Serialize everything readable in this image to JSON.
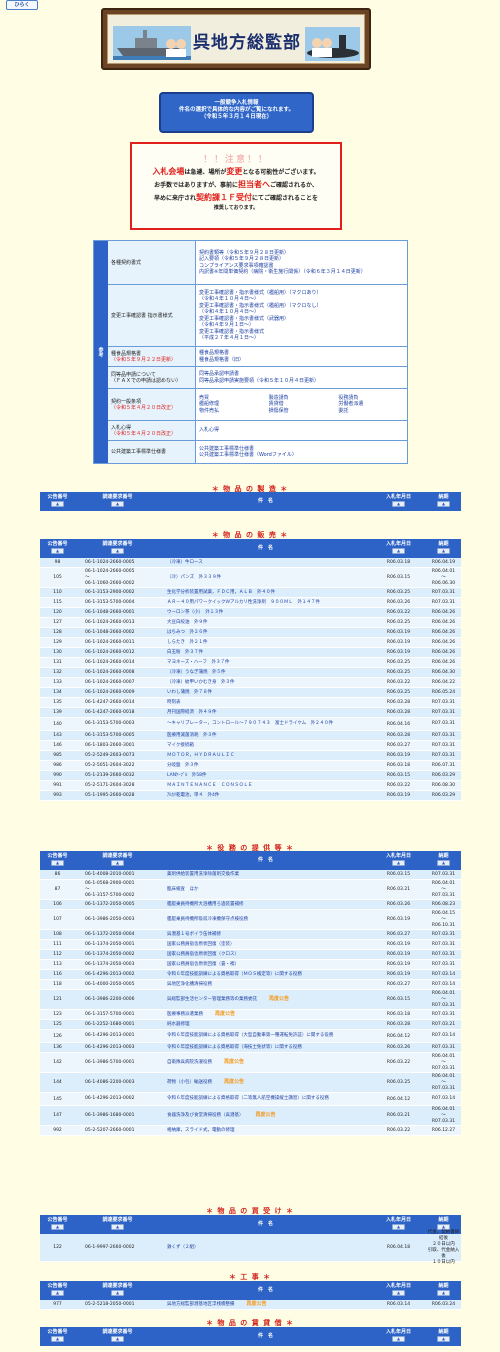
{
  "top": {
    "open_label": "ひらく"
  },
  "banner": {
    "title": "呉地方総監部"
  },
  "info": {
    "line1": "一般競争入札情報",
    "line2": "件名の選択で具体的な内容がご覧になれます。",
    "line3": "（令和５年３月１４日現在）"
  },
  "alert": {
    "title": "！！注意！！",
    "l1a": "入札会場",
    "l1b": "は急遽、場所が",
    "l1c": "変更",
    "l1d": "となる可能性がございます。",
    "l2a": "お手数ではありますが、事前に",
    "l2b": "担当者へ",
    "l2c": "ご確認されるか、",
    "l3a": "早めに来庁され",
    "l3b": "契約課１Ｆ受付",
    "l3c": "にてご確認されることを",
    "l4": "推奨しております。"
  },
  "links": {
    "side": "参考",
    "rows": [
      {
        "label": "各種契約書式",
        "values": [
          "契約書類等（令和５年９月２８日更新）",
          "記入要領（令和５年９月２８日更新）",
          "コンプライアンス要求事項確認書",
          "内訳書※年間単価契約（病院・衛生施行関係）（令和６年３月１４日更新）"
        ]
      },
      {
        "label": "変更工事確認書\n指示書様式",
        "values": [
          "変更工事確認書・指示書様式（艦船用）（マクロあり）",
          "（令和４年１０月４日～）",
          "変更工事確認書・指示書様式（艦船用）（マクロなし）",
          "（令和４年１０月４日～）",
          "変更工事確認書・指示書様式（武器用）",
          "（令和４年９月１日～）",
          "変更工事確認書・指示書様式",
          "（平成２７年４月１日～）"
        ]
      },
      {
        "label": "種食品規格書",
        "note": "（令和５年９月２２日更新）",
        "values": [
          "種食品規格書",
          "種食品規格書（旧）"
        ]
      },
      {
        "label": "同等品申請について",
        "note2": "（ＦＡＸでの申請は認めない）",
        "values": [
          "同等品承認申請書",
          "同等品承認申請実施要領（令和５年１０月４日更新）"
        ]
      },
      {
        "label": "契約一般条項",
        "note": "（令和５年４月２０日改正）",
        "grid": [
          "売買",
          "製造請負",
          "役務請負",
          "艦船修理",
          "賃貸借",
          "労働者派遣",
          "物件売払",
          "損傷保管",
          "委託"
        ]
      },
      {
        "label": "入札心得",
        "note": "（令和５年４月２０日改正）",
        "values": [
          "入札心得"
        ]
      },
      {
        "label": "公共建築工事標準仕様書",
        "values": [
          "公共建築工事標準仕様書",
          "公共建築工事標準仕様書（Wordファイル）"
        ]
      }
    ]
  },
  "headers": {
    "no": "公告番号",
    "code": "調達要求番号",
    "name": "件　名",
    "date": "入札年月日",
    "due": "納期",
    "sort": "▲"
  },
  "sections": {
    "seizo": {
      "title": "＊ 物 品 の 製 造 ＊"
    },
    "hanbai": {
      "title": "＊ 物 品 の 販 売 ＊",
      "rows": [
        {
          "no": "98",
          "code": "06-1-1024-2660-0005",
          "name": "（冷凍）牛ロース",
          "date": "R06.03.18",
          "due": "R06.04.19"
        },
        {
          "no": "105",
          "code": "06-1-1024-2660-0005\n～\n06-1-1060-2660-0002",
          "name": "（冷）パンズ　外３３９件",
          "date": "R06.03.15",
          "due": "R06.04.01\n～\nR06.06.30"
        },
        {
          "no": "110",
          "code": "06-1-3153-2900-0002",
          "name": "生化学分析装置用試薬，ＦＤＣ用，ＡＬＢ　外４０件",
          "date": "R06.03.25",
          "due": "R07.03.31"
        },
        {
          "no": "115",
          "code": "06-1-3153-5700-0004",
          "name": "ＡＲ－４０用パワークイックＷアルカリ性洗浄剤　９００ＭＬ　外１４７件",
          "date": "R06.03.26",
          "due": "R07.03.31"
        },
        {
          "no": "120",
          "code": "06-1-1048-2660-0001",
          "name": "ウーロン茶（小）　外１３件",
          "date": "R06.03.22",
          "due": "R06.04.26"
        },
        {
          "no": "127",
          "code": "06-1-1024-2660-0013",
          "name": "大豆白絞油　外９件",
          "date": "R06.03.25",
          "due": "R06.04.26"
        },
        {
          "no": "128",
          "code": "06-1-1048-2660-0002",
          "name": "はちみつ　外２６件",
          "date": "R06.03.19",
          "due": "R06.04.26"
        },
        {
          "no": "129",
          "code": "06-1-1024-2660-0011",
          "name": "しらたき　外２１件",
          "date": "R06.03.19",
          "due": "R06.04.26"
        },
        {
          "no": "130",
          "code": "06-1-1024-2660-0012",
          "name": "白玉粉　外３７件",
          "date": "R06.03.19",
          "due": "R06.04.26"
        },
        {
          "no": "131",
          "code": "06-1-1024-2660-0014",
          "name": "マヨネーズ・ハーフ　外３７件",
          "date": "R06.03.25",
          "due": "R06.04.26"
        },
        {
          "no": "132",
          "code": "06-1-1024-2660-0008",
          "name": "（冷凍）うなぎ蒲焼　外５件",
          "date": "R06.03.25",
          "due": "R06.04.30"
        },
        {
          "no": "133",
          "code": "06-1-1024-2660-0007",
          "name": "（冷凍）紋甲いかむき身　外３件",
          "date": "R06.03.22",
          "due": "R06.04.22"
        },
        {
          "no": "134",
          "code": "06-1-1024-2660-0009",
          "name": "いわし蒲焼　外７８件",
          "date": "R06.03.25",
          "due": "R06.05.24"
        },
        {
          "no": "135",
          "code": "06-1-4247-2660-0014",
          "name": "時刻表",
          "date": "R06.03.28",
          "due": "R07.03.31"
        },
        {
          "no": "139",
          "code": "06-1-4247-2660-0018",
          "name": "月刊国際経済　外４９件",
          "date": "R06.03.28",
          "due": "R07.03.31"
        },
        {
          "no": "140",
          "code": "06-1-3153-5700-0003",
          "name": "～キャリブレーター，コントロール～７９０７４３　富士ドライケム　外２４０件",
          "date": "R06.04.16",
          "due": "R07.03.31"
        },
        {
          "no": "143",
          "code": "06-1-3153-5700-0005",
          "name": "医療用滅菌消耗　外３件",
          "date": "R06.03.28",
          "due": "R07.03.31"
        },
        {
          "no": "146",
          "code": "06-1-1803-2660-3001",
          "name": "マイク接続箱",
          "date": "R06.03.27",
          "due": "R07.03.31"
        },
        {
          "no": "985",
          "code": "05-2-5249-2603-0073",
          "name": "ＭＯＴＯＲ，ＨＹＤＲＡＵＬＩＣ",
          "date": "R06.03.19",
          "due": "R07.03.31"
        },
        {
          "no": "986",
          "code": "05-2-5051-2604-3022",
          "name": "分岐盤　外３件",
          "date": "R06.03.18",
          "due": "R06.07.31"
        },
        {
          "no": "990",
          "code": "05-1-2139-2660-0032",
          "name": "LANｹｰﾌﾞﾙ　外58件",
          "date": "R06.03.15",
          "due": "R06.03.29"
        },
        {
          "no": "991",
          "code": "05-2-5171-2604-3028",
          "name": "ＭＡＩＮＴＥＮＡＮＣＥ　ＣＯＮＳＯＬＥ",
          "date": "R06.03.22",
          "due": "R06.08.30"
        },
        {
          "no": "993",
          "code": "05-1-1995-2660-0028",
          "name": "ｱﾙｶﾘ乾電池，単４　外4件",
          "date": "R06.03.19",
          "due": "R06.03.29"
        }
      ]
    },
    "ekimu": {
      "title": "＊ 役 務 の 提 供 等 ＊",
      "rows": [
        {
          "no": "86",
          "code": "06-1-4008-2010-0001",
          "name": "薬剤供給装置用洗浄除菌剤交換作業",
          "date": "R06.03.15",
          "due": "R07.03.31"
        },
        {
          "no": "87",
          "code": "06-1-0568-2900-0001\n～\n06-1-3157-5700-0002",
          "name": "臨床検査　ほか",
          "date": "R06.03.21",
          "due": "R06.04.01\n～\nR07.03.31"
        },
        {
          "no": "106",
          "code": "06-1-1372-2050-0005",
          "name": "艦艇乗員待機所大浴槽用ろ過装置補修",
          "date": "R06.03.26",
          "due": "R06.08.23"
        },
        {
          "no": "107",
          "code": "06-1-3986-2050-0003",
          "name": "艦艇乗員待機所吸収冷凍機保守点検役務",
          "date": "R06.03.19",
          "due": "R06.04.15\n～\nR06.10.31"
        },
        {
          "no": "108",
          "code": "06-1-1372-2050-0004",
          "name": "呉潜基１号ボイラ缶体補修",
          "date": "R06.03.27",
          "due": "R07.03.31"
        },
        {
          "no": "111",
          "code": "06-1-1374-2050-0001",
          "name": "国家公務員宿舎原状回復（塗装）",
          "date": "R06.03.19",
          "due": "R07.03.31"
        },
        {
          "no": "112",
          "code": "06-1-1374-2050-0002",
          "name": "国家公務員宿舎原状回復（クロス）",
          "date": "R06.03.19",
          "due": "R07.03.31"
        },
        {
          "no": "113",
          "code": "06-1-1374-2050-0003",
          "name": "国家公務員宿舎原状回復（畳・襖）",
          "date": "R06.03.19",
          "due": "R07.03.31"
        },
        {
          "no": "116",
          "code": "06-1-4296-2013-0002",
          "name": "令和６年度技能訓練による資格取得（ＭＯＳ検定等）に関する役務",
          "date": "R06.03.19",
          "due": "R07.03.14"
        },
        {
          "no": "118",
          "code": "06-1-4000-2050-0005",
          "name": "呉地区浄化槽清掃役務",
          "date": "R06.03.27",
          "due": "R07.03.14"
        },
        {
          "no": "121",
          "code": "06-1-3986-2200-0006",
          "name": "呉総監部生活センター管理業務等の業務委託",
          "tag": "再度公告",
          "date": "R06.03.15",
          "due": "R06.04.01\n～\nR07.03.31"
        },
        {
          "no": "123",
          "code": "06-1-3157-5700-0001",
          "name": "医療事務派遣業務",
          "tag": "再度公告",
          "date": "R06.03.18",
          "due": "R07.03.31"
        },
        {
          "no": "125",
          "code": "06-1-2252-1680-0001",
          "name": "純水器修理",
          "date": "R06.03.28",
          "due": "R07.03.21"
        },
        {
          "no": "126",
          "code": "06-1-4296-2013-0001",
          "name": "令和６年度技能訓練による資格取得（大型自動車第一種運転免許証）に関する役務",
          "date": "R06.04.12",
          "due": "R07.03.14"
        },
        {
          "no": "136",
          "code": "06-1-4296-2013-0003",
          "name": "令和６年度技能訓練による資格取得（海技士免状等）に関する役務",
          "date": "R06.03.26",
          "due": "R07.03.31"
        },
        {
          "no": "142",
          "code": "06-1-3986-5700-0001",
          "name": "自衛隊呉病院洗濯役務",
          "tag": "再度公告",
          "date": "R06.03.22",
          "due": "R06.04.01\n～\nR07.03.31"
        },
        {
          "no": "144",
          "code": "06-1-4086-2200-0003",
          "name": "荷物（小包）輸送役務",
          "tag": "再度公告",
          "date": "R06.03.25",
          "due": "R06.04.01\n～\nR07.03.31"
        },
        {
          "no": "145",
          "code": "06-1-4296-2013-0002",
          "name": "令和６年度技能訓練による資格取得（二等無人航空機操縦士講習）に関する役務",
          "date": "R06.04.12",
          "due": "R07.03.14"
        },
        {
          "no": "147",
          "code": "06-1-3986-1680-0001",
          "name": "食器洗浄及び食堂清掃役務（呉潜基）",
          "tag": "再度公告",
          "date": "R06.03.21",
          "due": "R06.04.01\n～\nR07.03.31"
        },
        {
          "no": "992",
          "code": "05-2-5207-2660-0001",
          "name": "格納庫，スライド式，電動の修理",
          "date": "R06.03.22",
          "due": "R06.12.27"
        }
      ]
    },
    "kaiuke": {
      "title": "＊ 物 品 の 買 受 け ＊",
      "rows": [
        {
          "no": "122",
          "code": "06-1-9997-2660-0002",
          "name": "鉄くず（２組）",
          "date": "R06.04.18",
          "due": "代金、契約書締結後\n２０日以内\n引取、代金納入後\n１０日以内"
        }
      ]
    },
    "koji": {
      "title": "＊ 工 事 ＊",
      "rows": [
        {
          "no": "977",
          "code": "05-2-5218-2050-0001",
          "name": "呉地方総監部潜基地区浮桟橋整備",
          "tag": "再度公告",
          "date": "R06.03.14",
          "due": "R06.03.24"
        }
      ]
    },
    "taishaku": {
      "title": "＊ 物 品 の 賃 貸 借 ＊"
    }
  }
}
